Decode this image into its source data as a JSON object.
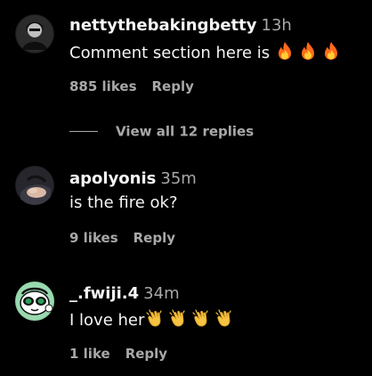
{
  "comments": [
    {
      "username": "nettythebakingbetty",
      "time": "13h",
      "text": "Comment section here is",
      "emojis": [
        "fire-emoji",
        "fire-emoji",
        "fire-emoji"
      ],
      "likes": "885 likes",
      "reply": "Reply",
      "view_replies": "View all 12 replies"
    },
    {
      "username": "apolyonis",
      "time": "35m",
      "text": "is the fire ok?",
      "likes": "9 likes",
      "reply": "Reply"
    },
    {
      "username": "_.fwiji.4",
      "time": "34m",
      "text": "I love her",
      "emojis": [
        "clapping-hands-emoji",
        "clapping-hands-emoji",
        "clapping-hands-emoji",
        "clapping-hands-emoji"
      ],
      "likes": "1 like",
      "reply": "Reply"
    }
  ],
  "colors": {
    "background": "#000000",
    "primary_text": "#f5f5f5",
    "secondary_text": "#a8a8a8",
    "fire_orange": "#ff6a1a",
    "fire_yellow": "#ffcf33",
    "clap_yellow": "#f6c343"
  }
}
